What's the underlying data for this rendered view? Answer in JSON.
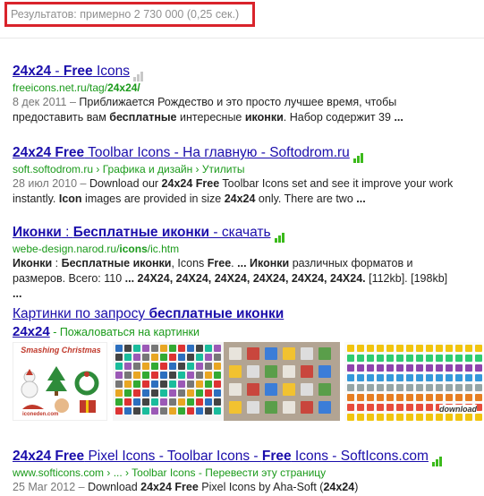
{
  "stats": "Результатов: примерно 2 730 000 (0,25 сек.)",
  "results": [
    {
      "title_parts": [
        {
          "t": "24x24",
          "b": true
        },
        {
          "t": " - ",
          "b": false
        },
        {
          "t": "Free",
          "b": true
        },
        {
          "t": " Icons",
          "b": false
        }
      ],
      "cite_plain": "freeicons.net.ru/tag/",
      "cite_bold": "24x24/",
      "date": "8 дек 2011 –",
      "snippet1": " Приближается Рождество и это просто лучшее время, чтобы предоставить вам ",
      "snippet_b1": "бесплатные",
      "snippet2": " интересные ",
      "snippet_b2": "иконки",
      "snippet3": ". Набор содержит 39 ",
      "snippet_b3": "...",
      "signal": "gray"
    },
    {
      "title_bold": "24x24 Free",
      "title_rest": " Toolbar Icons - На главную - Softodrom.ru",
      "cite": "soft.softodrom.ru › Графика и дизайн › Утилиты",
      "date": "28 июл 2010 –",
      "s1": " Download our ",
      "b1": "24x24 Free",
      "s2": " Toolbar Icons set and see it improve your work instantly. ",
      "b2": "Icon",
      "s3": " images are provided in size ",
      "b3": "24x24",
      "s4": " only. There are two ",
      "b4": "...",
      "signal": "green"
    },
    {
      "title_bold": "Иконки",
      "title_sep": " : ",
      "title_bold2": "Бесплатные иконки",
      "title_rest": " - скачать",
      "cite_plain1": "webe-design.narod.ru/",
      "cite_bold": "icons",
      "cite_plain2": "/ic.htm",
      "line1_b1": "Иконки",
      "line1_s1": " : ",
      "line1_b2": "Бесплатные иконки",
      "line1_s2": ", Icons ",
      "line1_b3": "Free",
      "line1_s3": ". ",
      "line1_b4": "... Иконки",
      "line1_s4": " различных форматов и размеров. Всего: 110 ",
      "line2": "... 24X24, 24X24, 24X24, 24X24, 24X24, 24X24.",
      "line2_tail": " [112kb]. [198kb] ",
      "line2_end": "...",
      "signal": "green"
    },
    {
      "title_bold": "24x24 Free",
      "title_rest1": " Pixel Icons - Toolbar Icons - ",
      "title_bold2": "Free",
      "title_rest2": " Icons - SoftIcons.com",
      "cite": "www.softicons.com › ... › Toolbar Icons - ",
      "cite_link": "Перевести эту страницу",
      "date": "25 Mar 2012 –",
      "s1": " Download ",
      "b1": "24x24 Free",
      "s2": " Pixel Icons by Aha-Soft (",
      "b2": "24x24",
      "s3": ")",
      "signal": "green"
    }
  ],
  "images": {
    "title_plain": "Картинки по запросу ",
    "title_bold": "бесплатные иконки",
    "sub_bold": "24x24",
    "sub_rest": " - Пожаловаться на картинки",
    "thumb1_text": "Smashing Christmas",
    "thumb1_footer": "iconeden.com",
    "thumb4_text": "download"
  }
}
